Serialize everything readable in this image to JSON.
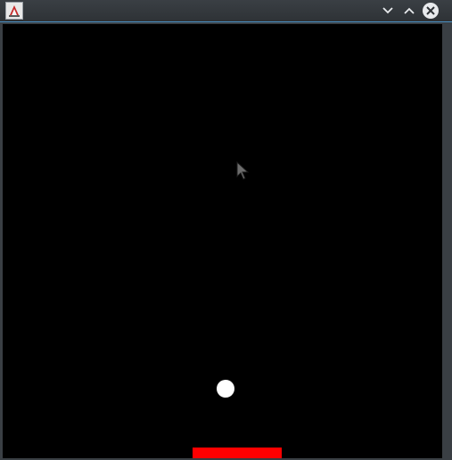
{
  "window": {
    "app_icon": "java-app-icon",
    "controls": {
      "minimize_icon": "chevron-down-icon",
      "maximize_icon": "chevron-up-icon",
      "close_icon": "close-icon"
    }
  },
  "game": {
    "background_color": "#000000",
    "ball_color": "#ffffff",
    "paddle_color": "#ff0000",
    "cursor_icon": "mouse-pointer-icon"
  }
}
